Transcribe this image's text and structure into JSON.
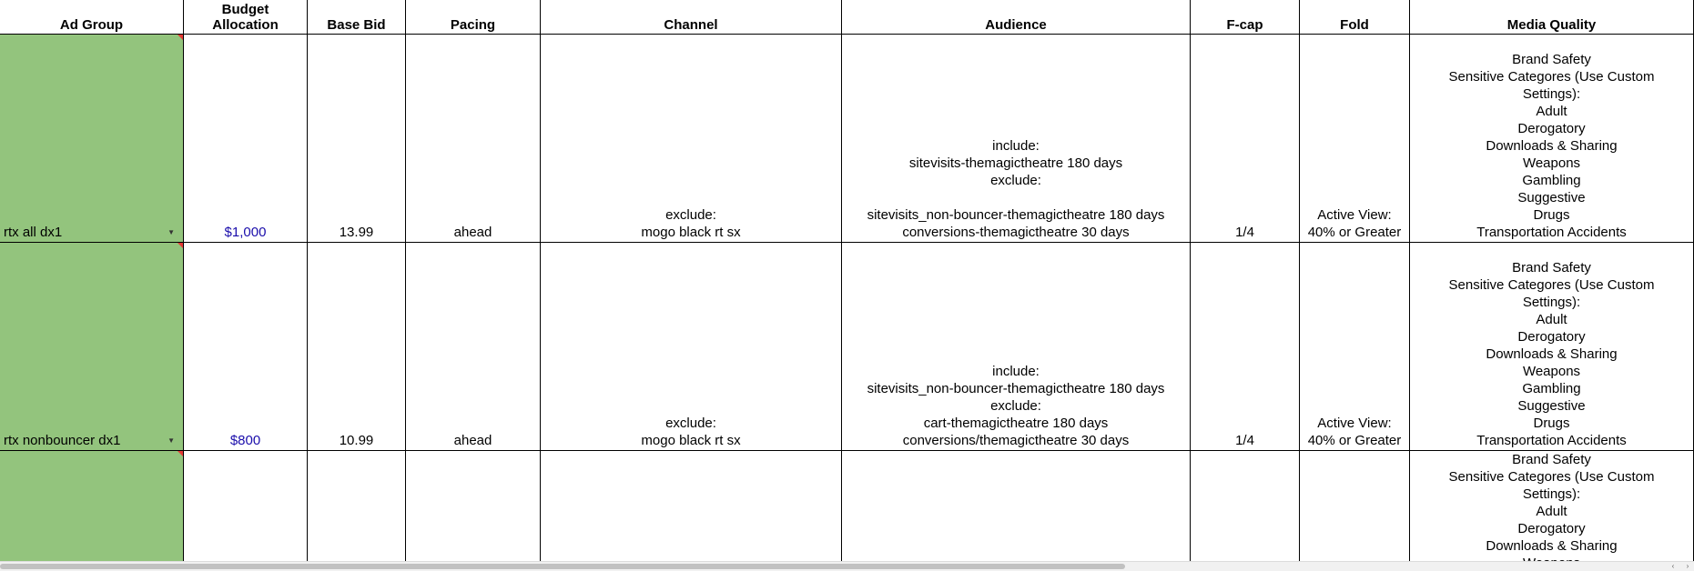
{
  "sheet": {
    "headers": [
      {
        "lines": [
          "Ad Group"
        ]
      },
      {
        "lines": [
          "Budget",
          "Allocation"
        ]
      },
      {
        "lines": [
          "Base Bid"
        ]
      },
      {
        "lines": [
          "Pacing"
        ]
      },
      {
        "lines": [
          "Channel"
        ]
      },
      {
        "lines": [
          "Audience"
        ]
      },
      {
        "lines": [
          "F-cap"
        ]
      },
      {
        "lines": [
          "Fold"
        ]
      },
      {
        "lines": [
          "Media Quality"
        ]
      }
    ],
    "rows": [
      {
        "ad_group": "rtx all dx1",
        "budget": "$1,000",
        "base_bid": "13.99",
        "pacing": "ahead",
        "channel": [
          "exclude:",
          "mogo black rt sx"
        ],
        "audience": [
          "include:",
          "sitevisits-themagictheatre 180 days",
          "exclude:",
          "",
          "sitevisits_non-bouncer-themagictheatre 180 days",
          "conversions-themagictheatre 30 days"
        ],
        "fcap": "1/4",
        "fold": [
          "Active View:",
          "40% or Greater"
        ],
        "media_quality": [
          "Brand Safety",
          "Sensitive Categores (Use Custom",
          "Settings):",
          "Adult",
          "Derogatory",
          "Downloads & Sharing",
          "Weapons",
          "Gambling",
          "Suggestive",
          "Drugs",
          "Transportation Accidents"
        ]
      },
      {
        "ad_group": "rtx nonbouncer dx1",
        "budget": "$800",
        "base_bid": "10.99",
        "pacing": "ahead",
        "channel": [
          "exclude:",
          "mogo black rt sx"
        ],
        "audience": [
          "include:",
          "sitevisits_non-bouncer-themagictheatre 180 days",
          "exclude:",
          "cart-themagictheatre 180 days",
          "conversions/themagictheatre 30 days"
        ],
        "fcap": "1/4",
        "fold": [
          "Active View:",
          "40% or Greater"
        ],
        "media_quality": [
          "Brand Safety",
          "Sensitive Categores (Use Custom",
          "Settings):",
          "Adult",
          "Derogatory",
          "Downloads & Sharing",
          "Weapons",
          "Gambling",
          "Suggestive",
          "Drugs",
          "Transportation Accidents"
        ]
      },
      {
        "ad_group": "",
        "budget": "",
        "base_bid": "",
        "pacing": "",
        "channel": [],
        "audience": [],
        "fcap": "",
        "fold": [],
        "media_quality": [
          "Brand Safety",
          "Sensitive Categores (Use Custom",
          "Settings):",
          "Adult",
          "Derogatory",
          "Downloads & Sharing",
          "Weapons"
        ]
      }
    ],
    "colors": {
      "adgroup_fill": "#93c47d",
      "link": "#1a0dab",
      "note_marker": "#e53935"
    },
    "icons": {
      "dropdown": "dropdown-arrow-icon",
      "note": "comment-marker-icon"
    }
  },
  "scrollbar": {
    "left_glyph": "‹",
    "right_glyph": "›"
  }
}
